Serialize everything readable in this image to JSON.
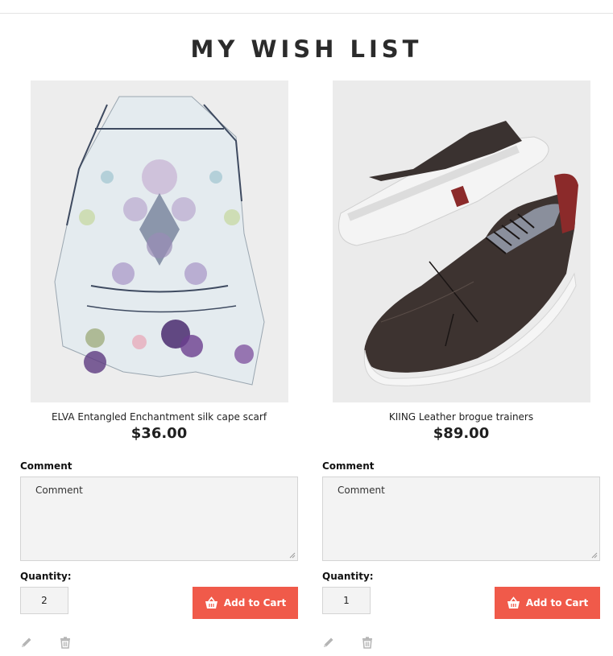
{
  "page": {
    "title": "MY WISH LIST"
  },
  "items": [
    {
      "name": "ELVA Entangled Enchantment silk cape scarf",
      "price": "$36.00",
      "comment_label": "Comment",
      "comment_placeholder": "Comment",
      "comment_value": "",
      "quantity_label": "Quantity:",
      "quantity": "2",
      "add_to_cart_label": "Add to Cart",
      "image_icon": "silk-cape-scarf-image",
      "actions": [
        "pencil-icon",
        "trash-icon"
      ]
    },
    {
      "name": "KIING Leather brogue trainers",
      "price": "$89.00",
      "comment_label": "Comment",
      "comment_placeholder": "Comment",
      "comment_value": "",
      "quantity_label": "Quantity:",
      "quantity": "1",
      "add_to_cart_label": "Add to Cart",
      "image_icon": "leather-trainers-image",
      "actions": [
        "pencil-icon",
        "trash-icon"
      ]
    }
  ],
  "colors": {
    "accent": "#f05a4a",
    "field_background": "#f3f3f3",
    "field_border": "#d4d4d4",
    "icon_gray": "#b5b5b5"
  }
}
